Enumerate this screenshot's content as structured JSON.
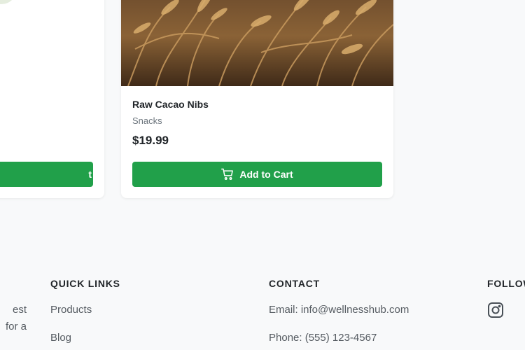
{
  "products": [
    {
      "name": "",
      "category": "",
      "price": "",
      "button_label": "t"
    },
    {
      "name": "Raw Cacao Nibs",
      "category": "Snacks",
      "price": "$19.99",
      "button_label": "Add to Cart"
    }
  ],
  "footer": {
    "about_fragment": [
      "est",
      "for a"
    ],
    "quick_links": {
      "heading": "QUICK LINKS",
      "items": [
        "Products",
        "Blog"
      ]
    },
    "contact": {
      "heading": "CONTACT",
      "email": "Email: info@wellnesshub.com",
      "phone": "Phone: (555) 123-4567"
    },
    "follow": {
      "heading": "FOLLOW",
      "icons": [
        "instagram-icon"
      ]
    }
  },
  "colors": {
    "page_bg": "#f8f9fa",
    "card_bg": "#ffffff",
    "primary_button": "#21a04a",
    "text": "#212529",
    "muted_text": "#6c757d"
  }
}
